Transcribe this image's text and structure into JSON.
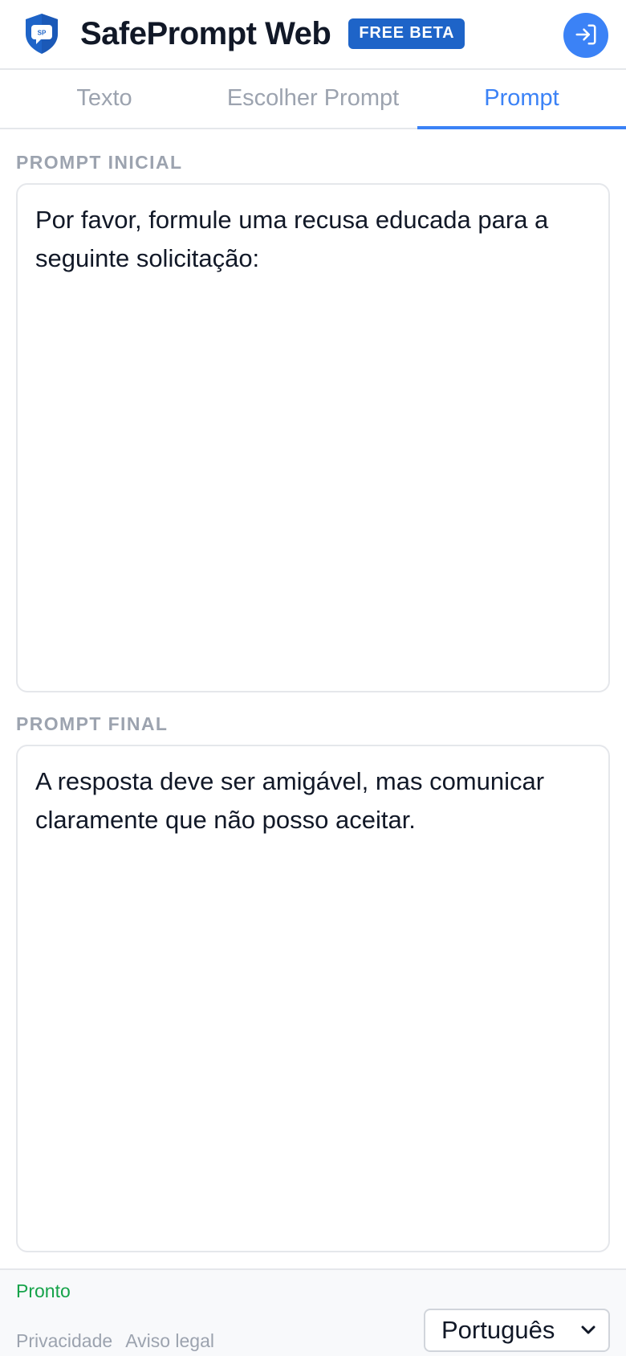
{
  "header": {
    "logo_text": "SP",
    "title": "SafePrompt Web",
    "badge": "FREE BETA",
    "login_icon": "login-icon"
  },
  "tabs": [
    {
      "label": "Texto",
      "active": false
    },
    {
      "label": "Escolher Prompt",
      "active": false
    },
    {
      "label": "Prompt",
      "active": true
    }
  ],
  "main": {
    "initial_label": "PROMPT INICIAL",
    "initial_value": "Por favor, formule uma recusa educada para a seguinte solicitação:",
    "final_label": "PROMPT FINAL",
    "final_value": "A resposta deve ser amigável, mas comunicar claramente que não posso aceitar."
  },
  "footer": {
    "status": "Pronto",
    "links": [
      "Privacidade",
      "Aviso legal"
    ],
    "language": "Português"
  },
  "colors": {
    "accent": "#3b82f6",
    "badge": "#1e64c8",
    "status": "#16a34a",
    "muted": "#9ca3af"
  }
}
